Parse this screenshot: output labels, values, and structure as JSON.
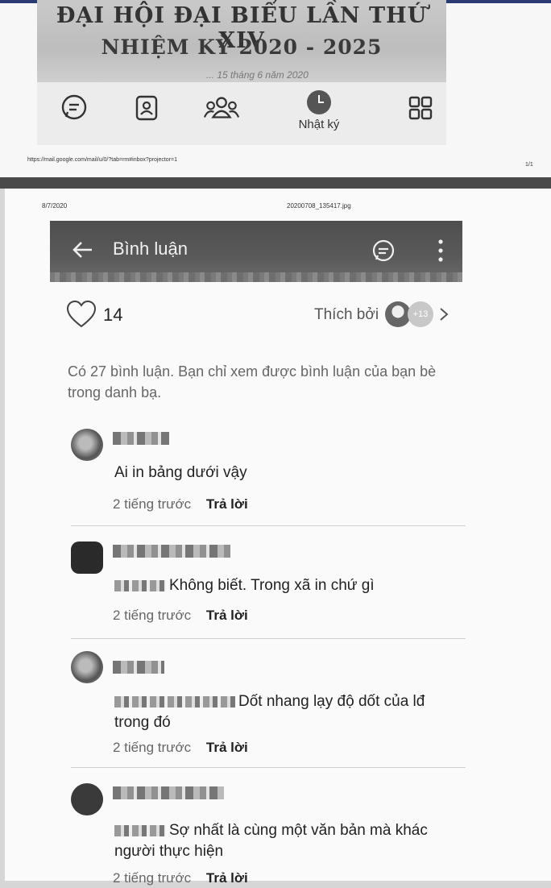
{
  "top_page": {
    "banner": {
      "line1": "ĐẠI HỘI ĐẠI BIỂU LẦN THỨ XIV",
      "line2": "NHIỆM KỲ 2020 - 2025",
      "line3": "... 15 tháng 6 năm 2020"
    },
    "bottom_nav": {
      "items": [
        {
          "name": "messages",
          "icon": "chat-bubble-icon"
        },
        {
          "name": "contacts",
          "icon": "contact-card-icon"
        },
        {
          "name": "groups",
          "icon": "people-group-icon"
        },
        {
          "name": "diary",
          "icon": "clock-icon",
          "label": "Nhật ký"
        },
        {
          "name": "more",
          "icon": "grid-icon"
        }
      ]
    },
    "print_url": "https://mail.google.com/mail/u/0/?tab=rm#inbox?projector=1",
    "print_pager": "1/1"
  },
  "page2": {
    "print_date": "8/7/2020",
    "print_filename": "20200708_135417.jpg",
    "header": {
      "title": "Bình luận"
    },
    "likes": {
      "count": "14",
      "liked_by_label": "Thích bởi",
      "more_count": "+13"
    },
    "comments_note": "Có 27 bình luận. Bạn chỉ xem được bình luận của bạn bè trong danh bạ.",
    "comments": [
      {
        "text": "Ai in bảng dưới vậy",
        "time": "2 tiếng trước",
        "reply": "Trả lời"
      },
      {
        "text": "Không biết. Trong xã in chứ gì",
        "time": "2 tiếng trước",
        "reply": "Trả lời"
      },
      {
        "text": "Dốt nhang lạy độ dốt của lđ trong đó",
        "time": "2 tiếng trước",
        "reply": "Trả lời"
      },
      {
        "text": "Sợ nhất là cùng một văn bản mà khác người thực hiện",
        "time": "2 tiếng trước",
        "reply": "Trả lời"
      }
    ]
  },
  "colors": {
    "header_bg": "#555555",
    "muted_text": "#666666"
  }
}
